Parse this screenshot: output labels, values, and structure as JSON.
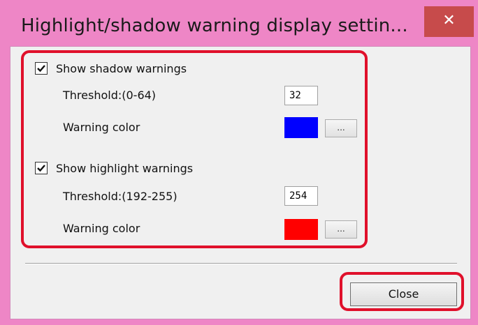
{
  "window": {
    "title": "Highlight/shadow warning display settin...",
    "close_glyph": "✕",
    "titlebar_color": "#ee86c6",
    "close_color": "#c74b4b"
  },
  "shadow": {
    "checkbox_label": "Show shadow warnings",
    "checked": true,
    "threshold_label": "Threshold:(0-64)",
    "threshold_value": "32",
    "color_label": "Warning color",
    "color": "#0000ff",
    "picker_label": "..."
  },
  "highlight": {
    "checkbox_label": "Show highlight warnings",
    "checked": true,
    "threshold_label": "Threshold:(192-255)",
    "threshold_value": "254",
    "color_label": "Warning color",
    "color": "#ff0000",
    "picker_label": "..."
  },
  "footer": {
    "close_label": "Close"
  },
  "annotations": {
    "outline_color": "#e0102b"
  },
  "icons": {
    "checkmark": "check-icon",
    "close": "close-icon"
  }
}
